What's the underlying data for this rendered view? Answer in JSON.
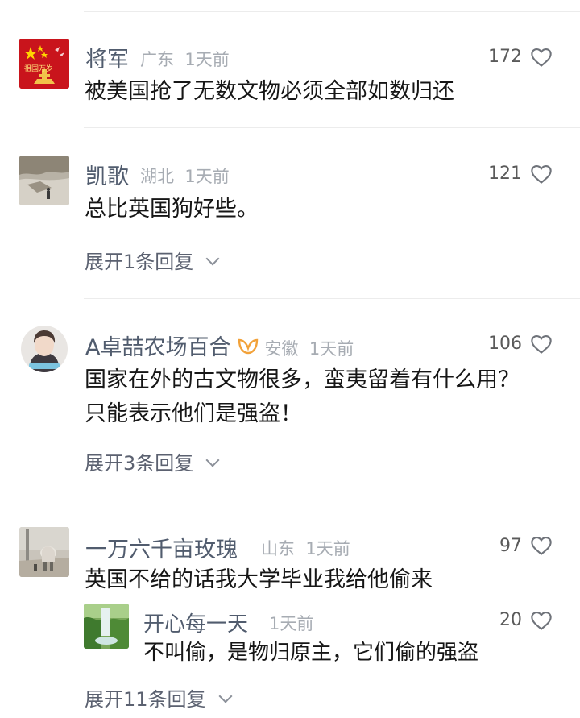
{
  "comments": [
    {
      "name": "将军",
      "location": "广东",
      "time": "1天前",
      "likes": "172",
      "text": "被美国抢了无数文物必须全部如数归还",
      "avatar_text": "祖国万岁"
    },
    {
      "name": "凯歌",
      "location": "湖北",
      "time": "1天前",
      "likes": "121",
      "text": "总比英国狗好些。",
      "expand": "展开1条回复"
    },
    {
      "name": "A卓喆农场百合",
      "location": "安徽",
      "time": "1天前",
      "likes": "106",
      "text": "国家在外的古文物很多，蛮夷留着有什么用？ 只能表示他们是强盗！",
      "expand": "展开3条回复",
      "badge_color": "#f2a23a"
    },
    {
      "name": "一万六千亩玫瑰",
      "location": "山东",
      "time": "1天前",
      "likes": "97",
      "text": "英国不给的话我大学毕业我给他偷来",
      "expand": "展开11条回复",
      "reply": {
        "name": "开心每一天",
        "time": "1天前",
        "likes": "20",
        "text": "不叫偷，是物归原主，它们偷的强盗"
      }
    }
  ],
  "icons": {
    "like": "heart-outline-icon",
    "expand": "chevron-down-icon"
  }
}
